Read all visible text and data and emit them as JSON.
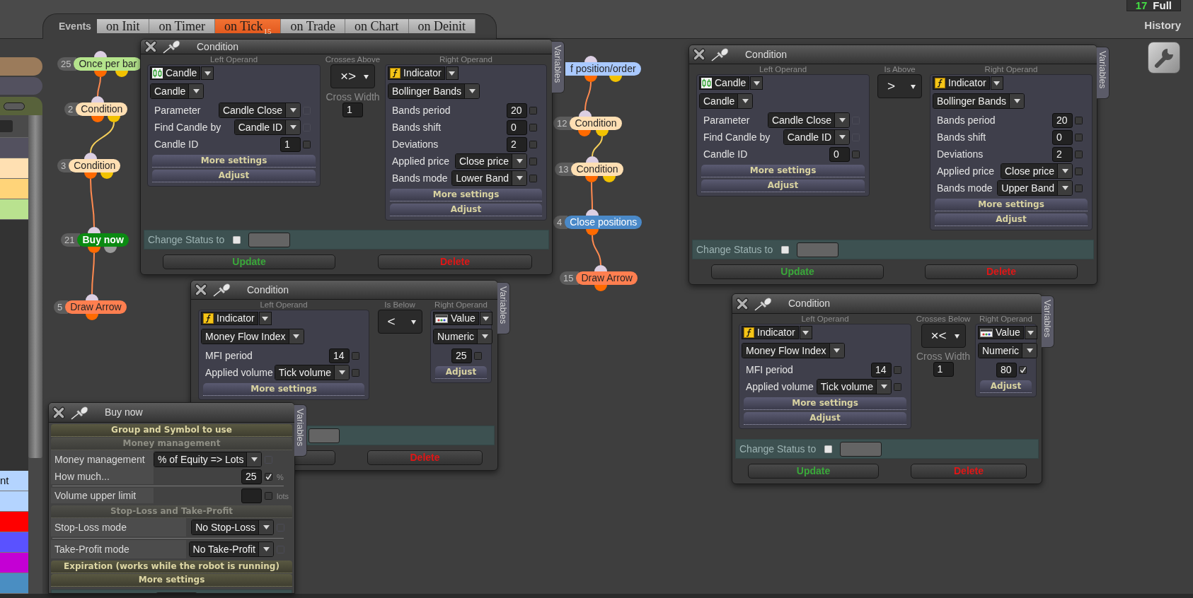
{
  "events": {
    "label": "Events",
    "tabs": [
      {
        "label": "on Init",
        "selected": false
      },
      {
        "label": "on Timer",
        "selected": false
      },
      {
        "label": "on Tick",
        "count": "15",
        "selected": true
      },
      {
        "label": "on Trade",
        "selected": false
      },
      {
        "label": "on Chart",
        "selected": false
      },
      {
        "label": "on Deinit",
        "selected": false
      }
    ]
  },
  "status": {
    "count": "17",
    "mode": "Full",
    "link": "History"
  },
  "sidebar": {
    "tabs": [
      {
        "color": "#9b7b5b"
      },
      {
        "color": "#53515f"
      },
      {
        "color": "#58623b"
      }
    ],
    "upper_rows": [
      {
        "color": "#53515f"
      },
      {
        "color": "#ffe0b2"
      },
      {
        "color": "#ffd479"
      },
      {
        "color": "#b9e28f"
      }
    ],
    "lower_rows": [
      {
        "color": "#b4d4ff",
        "label": "nt"
      },
      {
        "color": "#b4d4ff"
      },
      {
        "color": "#ff0000"
      },
      {
        "color": "#5a52ff"
      },
      {
        "color": "#c400d4"
      },
      {
        "color": "#4a8ec2"
      }
    ]
  },
  "flows": [
    {
      "nodes": [
        {
          "number": "25",
          "label": "Once per bar",
          "color": "#b5e48c",
          "bold": false,
          "outputs": [
            {
              "color": "#ff6a00"
            },
            {
              "color": "#f2c200"
            }
          ],
          "link": {
            "color": "#ff8a50"
          }
        },
        {
          "number": "2",
          "label": "Condition",
          "color": "#ffdfb3",
          "bold": false,
          "outputs": [
            {
              "color": "#ff6a00"
            },
            {
              "color": "#f2c200"
            }
          ],
          "link": {
            "color": "#f5cf5a"
          }
        },
        {
          "number": "3",
          "label": "Condition",
          "color": "#ffdfb3",
          "bold": false,
          "outputs": [
            {
              "color": "#ff6a00"
            },
            {
              "color": "#f2c200"
            }
          ],
          "link": {
            "color": "#ff8a50"
          }
        },
        {
          "number": "21",
          "label": "Buy now",
          "color": "#0b8a12",
          "bold": true,
          "outputs": [
            {
              "color": "#ff6a00"
            },
            {
              "color": "#9a9a9a"
            }
          ],
          "link": {
            "color": "#ff8a50"
          }
        },
        {
          "number": "5",
          "label": "Draw Arrow",
          "color": "#ff7f50",
          "bold": false,
          "outputs": [
            {
              "color": "#ff6a00"
            }
          ]
        }
      ]
    },
    {
      "nodes": [
        {
          "label": "f position/order",
          "color": "#a9c9ff",
          "bold": false,
          "outputs": [
            {
              "color": "#ff6a00"
            },
            {
              "color": "#f2c200"
            }
          ],
          "link": {
            "color": "#ff8a50"
          }
        },
        {
          "number": "12",
          "label": "Condition",
          "color": "#ffdfb3",
          "bold": false,
          "outputs": [
            {
              "color": "#ff6a00"
            },
            {
              "color": "#f2c200"
            }
          ],
          "link": {
            "color": "#f5cf5a"
          }
        },
        {
          "number": "13",
          "label": "Condition",
          "color": "#ffdfb3",
          "bold": false,
          "outputs": [
            {
              "color": "#ff6a00"
            },
            {
              "color": "#f2c200"
            }
          ],
          "link": {
            "color": "#ff8a50"
          }
        },
        {
          "number": "4",
          "label": "Close positions",
          "color": "#4a89c8",
          "bold": false,
          "outputs": [
            {
              "color": "#ff6a00"
            }
          ],
          "link": {
            "color": "#ff8a50"
          }
        },
        {
          "number": "15",
          "label": "Draw Arrow",
          "color": "#ff7f50",
          "bold": false,
          "outputs": [
            {
              "color": "#ff6a00"
            }
          ]
        }
      ]
    }
  ],
  "windows": [
    {
      "kind": "condition",
      "title": "Condition",
      "side_tab": "Variables",
      "left_operand": {
        "heading": "Left Operand",
        "kind": "candle",
        "type": "Candle",
        "subtype": "Candle",
        "params": [
          {
            "kind": "select",
            "label": "Parameter",
            "value": "Candle Close",
            "checked": false,
            "disabled": true
          },
          {
            "kind": "select",
            "label": "Find Candle by",
            "value": "Candle ID",
            "checked": false,
            "disabled": true
          },
          {
            "kind": "number",
            "label": "Candle ID",
            "value": "1",
            "checked": false,
            "disabled": false
          }
        ],
        "buttons": [
          {
            "label": "More settings"
          },
          {
            "label": "Adjust"
          }
        ]
      },
      "operator": {
        "heading": "Crosses Above",
        "symbol": "×>",
        "cross_width": {
          "label": "Cross Width",
          "value": "1"
        }
      },
      "right_operand": {
        "heading": "Right Operand",
        "kind": "indicator",
        "type": "Indicator",
        "subtype": "Bollinger Bands",
        "params": [
          {
            "kind": "number",
            "label": "Bands period",
            "value": "20",
            "checked": false,
            "disabled": false
          },
          {
            "kind": "number",
            "label": "Bands shift",
            "value": "0",
            "checked": false,
            "disabled": false
          },
          {
            "kind": "number",
            "label": "Deviations",
            "value": "2",
            "checked": false,
            "disabled": false
          },
          {
            "kind": "select",
            "label": "Applied price",
            "value": "Close price",
            "checked": false,
            "disabled": false
          },
          {
            "kind": "select",
            "label": "Bands mode",
            "value": "Lower Band",
            "checked": false,
            "disabled": false
          }
        ],
        "buttons": [
          {
            "label": "More settings"
          },
          {
            "label": "Adjust"
          }
        ]
      },
      "change_status": {
        "label": "Change Status to",
        "checked": false
      },
      "buttons": [
        {
          "kind": "update",
          "label": "Update"
        },
        {
          "kind": "delete",
          "label": "Delete"
        }
      ]
    },
    {
      "kind": "condition",
      "title": "Condition",
      "side_tab": "Variables",
      "left_operand": {
        "heading": "Left Operand",
        "kind": "candle",
        "type": "Candle",
        "subtype": "Candle",
        "params": [
          {
            "kind": "select",
            "label": "Parameter",
            "value": "Candle Close",
            "checked": false,
            "disabled": true
          },
          {
            "kind": "select",
            "label": "Find Candle by",
            "value": "Candle ID",
            "checked": false,
            "disabled": true
          },
          {
            "kind": "number",
            "label": "Candle ID",
            "value": "0",
            "checked": false,
            "disabled": false
          }
        ],
        "buttons": [
          {
            "label": "More settings"
          },
          {
            "label": "Adjust"
          }
        ]
      },
      "operator": {
        "heading": "Is Above",
        "symbol": ">"
      },
      "right_operand": {
        "heading": "Right Operand",
        "kind": "indicator",
        "type": "Indicator",
        "subtype": "Bollinger Bands",
        "params": [
          {
            "kind": "number",
            "label": "Bands period",
            "value": "20",
            "checked": false,
            "disabled": false
          },
          {
            "kind": "number",
            "label": "Bands shift",
            "value": "0",
            "checked": false,
            "disabled": false
          },
          {
            "kind": "number",
            "label": "Deviations",
            "value": "2",
            "checked": false,
            "disabled": false
          },
          {
            "kind": "select",
            "label": "Applied price",
            "value": "Close price",
            "checked": false,
            "disabled": false
          },
          {
            "kind": "select",
            "label": "Bands mode",
            "value": "Upper Band",
            "checked": false,
            "disabled": false
          }
        ],
        "buttons": [
          {
            "label": "More settings"
          },
          {
            "label": "Adjust"
          }
        ]
      },
      "change_status": {
        "label": "Change Status to",
        "checked": false
      },
      "buttons": [
        {
          "kind": "update",
          "label": "Update"
        },
        {
          "kind": "delete",
          "label": "Delete"
        }
      ]
    },
    {
      "kind": "condition",
      "title": "Condition",
      "side_tab": "Variables",
      "left_operand": {
        "heading": "Left Operand",
        "kind": "indicator",
        "type": "Indicator",
        "subtype": "Money Flow Index",
        "params": [
          {
            "kind": "number",
            "label": "MFI period",
            "value": "14",
            "checked": false,
            "disabled": false
          },
          {
            "kind": "select",
            "label": "Applied volume",
            "value": "Tick volume",
            "checked": false,
            "disabled": false
          }
        ],
        "buttons": [
          {
            "label": "More settings"
          }
        ]
      },
      "operator": {
        "heading": "Is Below",
        "symbol": "<"
      },
      "right_operand": {
        "heading": "Right Operand",
        "kind": "value",
        "type": "Value",
        "subtype": "Numeric",
        "params": [
          {
            "kind": "number",
            "value": "25",
            "checked": false,
            "disabled": false
          }
        ],
        "buttons": [
          {
            "label": "Adjust"
          }
        ]
      },
      "buttons": [
        {
          "kind": "delete",
          "label": "Delete"
        }
      ]
    },
    {
      "kind": "condition",
      "title": "Condition",
      "side_tab": "Variables",
      "left_operand": {
        "heading": "Left Operand",
        "kind": "indicator",
        "type": "Indicator",
        "subtype": "Money Flow Index",
        "params": [
          {
            "kind": "number",
            "label": "MFI period",
            "value": "14",
            "checked": false,
            "disabled": false
          },
          {
            "kind": "select",
            "label": "Applied volume",
            "value": "Tick volume",
            "checked": false,
            "disabled": false
          }
        ],
        "buttons": [
          {
            "label": "More settings"
          },
          {
            "label": "Adjust"
          }
        ]
      },
      "operator": {
        "heading": "Crosses Below",
        "symbol": "×<",
        "cross_width": {
          "label": "Cross Width",
          "value": "1"
        }
      },
      "right_operand": {
        "heading": "Right Operand",
        "kind": "value",
        "type": "Value",
        "subtype": "Numeric",
        "params": [
          {
            "kind": "number",
            "value": "80",
            "checked": true,
            "disabled": false
          }
        ],
        "buttons": [
          {
            "label": "Adjust"
          }
        ]
      },
      "change_status": {
        "label": "Change Status to",
        "checked": false
      },
      "buttons": [
        {
          "kind": "update",
          "label": "Update"
        },
        {
          "kind": "delete",
          "label": "Delete"
        }
      ]
    },
    {
      "kind": "action",
      "title": "Buy now",
      "side_tab": "Variables",
      "sections": [
        {
          "kind": "header",
          "label": "Group and Symbol to use",
          "dimmed": false
        },
        {
          "kind": "header",
          "label": "Money management",
          "dimmed": true
        },
        {
          "kind": "select",
          "label": "Money management",
          "value": "% of Equity => Lots",
          "checked": false,
          "disabled": true
        },
        {
          "kind": "number",
          "label": "How much...",
          "value": "25",
          "unit": "%",
          "checked": true,
          "disabled": false
        },
        {
          "kind": "divider"
        },
        {
          "kind": "number",
          "label": "Volume upper limit",
          "unit": "lots",
          "checked": false,
          "disabled": false
        },
        {
          "kind": "header",
          "label": "Stop-Loss and Take-Profit",
          "dimmed": true
        },
        {
          "kind": "select",
          "label": "Stop-Loss mode",
          "value": "No Stop-Loss",
          "checked": false,
          "disabled": true
        },
        {
          "kind": "divider"
        },
        {
          "kind": "select",
          "label": "Take-Profit mode",
          "value": "No Take-Profit",
          "checked": false,
          "disabled": true
        },
        {
          "kind": "header",
          "label": "Expiration (works while the robot is running)",
          "dimmed": false
        },
        {
          "kind": "header",
          "label": "More settings",
          "dimmed": false
        }
      ]
    }
  ]
}
